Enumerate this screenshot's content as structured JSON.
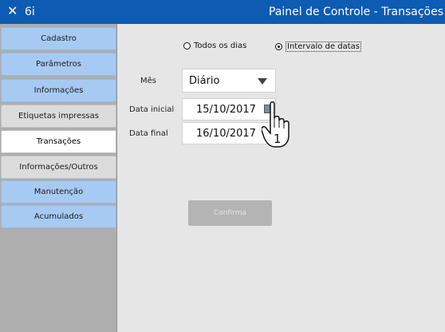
{
  "titlebar": {
    "close_icon": "close-icon",
    "app_name": "6i",
    "title": "Painel de Controle - Transações"
  },
  "sidebar": {
    "items": [
      {
        "label": "Cadastro",
        "style": "blue"
      },
      {
        "label": "Parâmetros",
        "style": "blue"
      },
      {
        "label": "Informações",
        "style": "blue"
      },
      {
        "label": "Etiquetas impressas",
        "style": "plain"
      },
      {
        "label": "Transações",
        "style": "active"
      },
      {
        "label": "Informações/Outros",
        "style": "plain"
      },
      {
        "label": "Manutenção",
        "style": "blue"
      },
      {
        "label": "Acumulados",
        "style": "blue"
      }
    ]
  },
  "filters": {
    "radio_all_days": "Todos os dias",
    "radio_date_range": "Intervalo de datas",
    "selected": "Intervalo de datas",
    "month_label": "Mês",
    "month_value": "Diário",
    "start_label": "Data inicial",
    "start_value": "15/10/2017",
    "end_label": "Data final",
    "end_value": "16/10/2017"
  },
  "actions": {
    "confirm_label": "Confirma",
    "confirm_enabled": false
  },
  "cursor": {
    "icon": "hand-pointer-icon",
    "badge": "1"
  },
  "colors": {
    "titlebar": "#0e5bb3",
    "nav_blue": "#a7caf3",
    "nav_plain": "#dcdcdc",
    "content_bg": "#e6e6e6",
    "sidebar_bg": "#aeaeae"
  }
}
